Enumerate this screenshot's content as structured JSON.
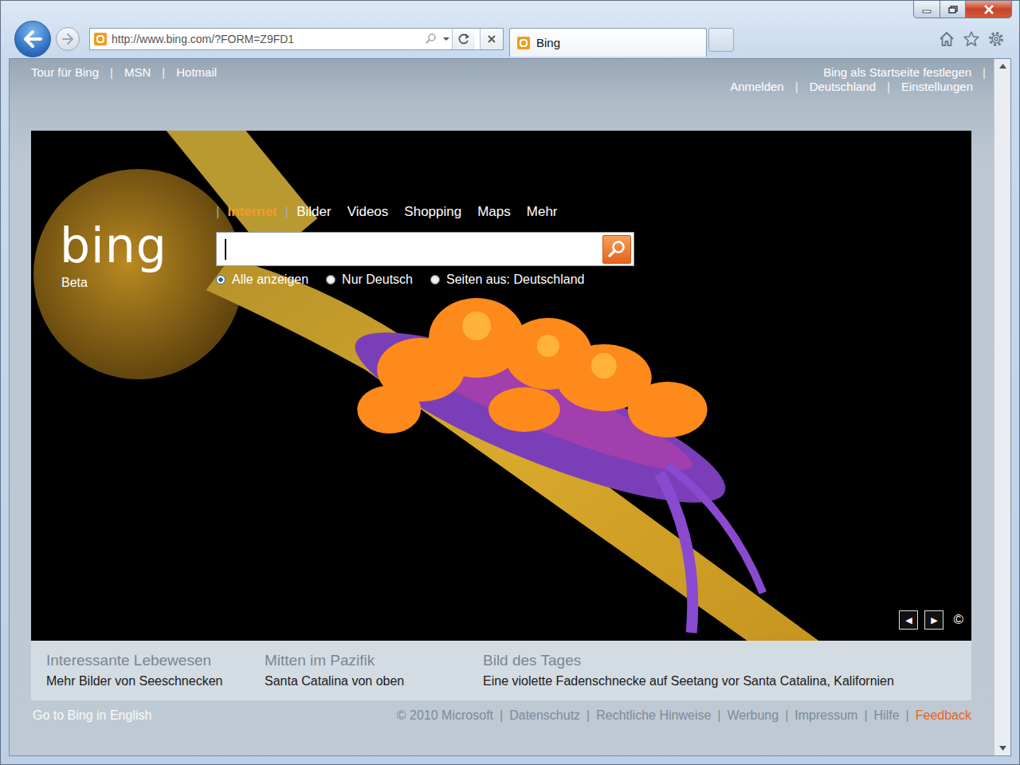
{
  "browser": {
    "address": "http://www.bing.com/?FORM=Z9FD1",
    "tabs": [
      {
        "label": "Bing",
        "selected": true
      }
    ]
  },
  "page": {
    "separator": "|",
    "top_links": [
      "Tour für Bing",
      "MSN",
      "Hotmail"
    ],
    "account_links": [
      {
        "items": [
          "Bing als Startseite festlegen"
        ],
        "trailing_separator": true
      },
      {
        "items": [
          "Anmelden",
          "Deutschland",
          "Einstellungen"
        ],
        "trailing_separator": false
      }
    ],
    "logo": {
      "text": "bing",
      "badge": "Beta"
    },
    "verticals": [
      {
        "label": "Internet",
        "selected": true
      },
      {
        "label": "Bilder",
        "selected": false
      },
      {
        "label": "Videos",
        "selected": false
      },
      {
        "label": "Shopping",
        "selected": false
      },
      {
        "label": "Maps",
        "selected": false
      },
      {
        "label": "Mehr",
        "selected": false
      }
    ],
    "search": {
      "value": "",
      "focused": true
    },
    "scopes": [
      {
        "label": "Alle anzeigen",
        "selected": true
      },
      {
        "label": "Nur Deutsch",
        "selected": false
      },
      {
        "label": "Seiten aus: Deutschland",
        "selected": false
      }
    ],
    "image_controls": {
      "previous": "◀",
      "next": "▶",
      "copyright": "©"
    },
    "hotspots": [
      {
        "title": "Interessante Lebewesen",
        "link": "Mehr Bilder von Seeschnecken"
      },
      {
        "title": "Mitten im Pazifik",
        "link": "Santa Catalina von oben"
      },
      {
        "title": "Bild des Tages",
        "link": "Eine violette Fadenschnecke auf Seetang vor Santa Catalina, Kalifornien"
      }
    ],
    "footer": {
      "language_link": "Go to Bing in English",
      "links": [
        "© 2010 Microsoft",
        "Datenschutz",
        "Rechtliche Hinweise",
        "Werbung",
        "Impressum",
        "Hilfe"
      ],
      "feedback": "Feedback"
    }
  }
}
